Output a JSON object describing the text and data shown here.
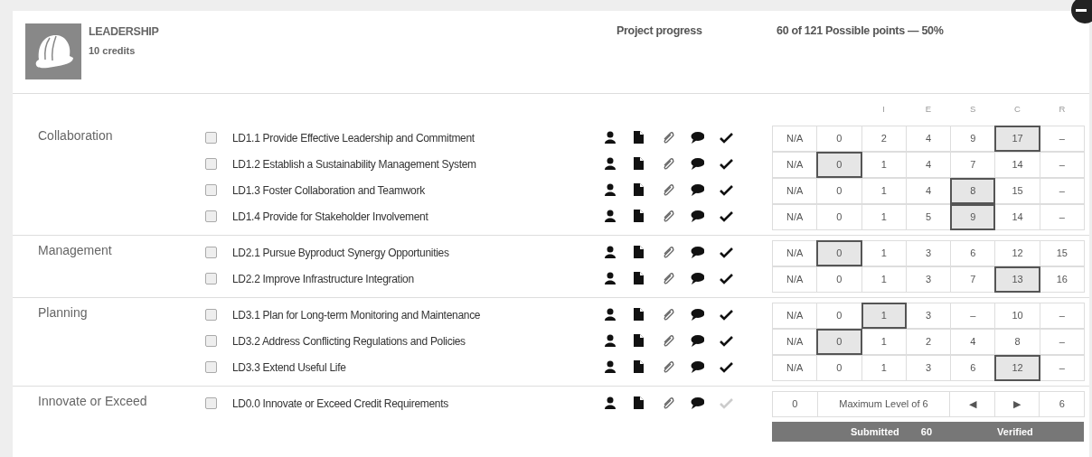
{
  "header": {
    "title": "LEADERSHIP",
    "credits": "10 credits",
    "progress_label": "Project progress",
    "points": "60 of 121 Possible points — 50%"
  },
  "score_columns": [
    "I",
    "E",
    "S",
    "C",
    "R"
  ],
  "sections": [
    {
      "name": "Collaboration",
      "credits": [
        {
          "kind": "levels",
          "label": "LD1.1 Provide Effective Leadership and Commitment",
          "checked": false,
          "done": true,
          "scores": [
            {
              "value": "N/A",
              "selected": false
            },
            {
              "value": "0",
              "selected": false
            },
            {
              "value": "2",
              "selected": false
            },
            {
              "value": "4",
              "selected": false
            },
            {
              "value": "9",
              "selected": false
            },
            {
              "value": "17",
              "selected": true
            },
            {
              "value": "–",
              "selected": false
            }
          ]
        },
        {
          "kind": "levels",
          "label": "LD1.2 Establish a Sustainability Management System",
          "checked": false,
          "done": true,
          "scores": [
            {
              "value": "N/A",
              "selected": false
            },
            {
              "value": "0",
              "selected": true
            },
            {
              "value": "1",
              "selected": false
            },
            {
              "value": "4",
              "selected": false
            },
            {
              "value": "7",
              "selected": false
            },
            {
              "value": "14",
              "selected": false
            },
            {
              "value": "–",
              "selected": false
            }
          ]
        },
        {
          "kind": "levels",
          "label": "LD1.3 Foster Collaboration and Teamwork",
          "checked": false,
          "done": true,
          "scores": [
            {
              "value": "N/A",
              "selected": false
            },
            {
              "value": "0",
              "selected": false
            },
            {
              "value": "1",
              "selected": false
            },
            {
              "value": "4",
              "selected": false
            },
            {
              "value": "8",
              "selected": true
            },
            {
              "value": "15",
              "selected": false
            },
            {
              "value": "–",
              "selected": false
            }
          ]
        },
        {
          "kind": "levels",
          "label": "LD1.4 Provide for Stakeholder Involvement",
          "checked": false,
          "done": true,
          "scores": [
            {
              "value": "N/A",
              "selected": false
            },
            {
              "value": "0",
              "selected": false
            },
            {
              "value": "1",
              "selected": false
            },
            {
              "value": "5",
              "selected": false
            },
            {
              "value": "9",
              "selected": true
            },
            {
              "value": "14",
              "selected": false
            },
            {
              "value": "–",
              "selected": false
            }
          ]
        }
      ]
    },
    {
      "name": "Management",
      "credits": [
        {
          "kind": "levels",
          "label": "LD2.1 Pursue Byproduct Synergy Opportunities",
          "checked": false,
          "done": true,
          "scores": [
            {
              "value": "N/A",
              "selected": false
            },
            {
              "value": "0",
              "selected": true
            },
            {
              "value": "1",
              "selected": false
            },
            {
              "value": "3",
              "selected": false
            },
            {
              "value": "6",
              "selected": false
            },
            {
              "value": "12",
              "selected": false
            },
            {
              "value": "15",
              "selected": false
            }
          ]
        },
        {
          "kind": "levels",
          "label": "LD2.2 Improve Infrastructure Integration",
          "checked": false,
          "done": true,
          "scores": [
            {
              "value": "N/A",
              "selected": false
            },
            {
              "value": "0",
              "selected": false
            },
            {
              "value": "1",
              "selected": false
            },
            {
              "value": "3",
              "selected": false
            },
            {
              "value": "7",
              "selected": false
            },
            {
              "value": "13",
              "selected": true
            },
            {
              "value": "16",
              "selected": false
            }
          ]
        }
      ]
    },
    {
      "name": "Planning",
      "credits": [
        {
          "kind": "levels",
          "label": "LD3.1 Plan for Long-term Monitoring and Maintenance",
          "checked": false,
          "done": true,
          "scores": [
            {
              "value": "N/A",
              "selected": false
            },
            {
              "value": "0",
              "selected": false
            },
            {
              "value": "1",
              "selected": true
            },
            {
              "value": "3",
              "selected": false
            },
            {
              "value": "–",
              "selected": false
            },
            {
              "value": "10",
              "selected": false
            },
            {
              "value": "–",
              "selected": false
            }
          ]
        },
        {
          "kind": "levels",
          "label": "LD3.2 Address Conflicting Regulations and Policies",
          "checked": false,
          "done": true,
          "scores": [
            {
              "value": "N/A",
              "selected": false
            },
            {
              "value": "0",
              "selected": true
            },
            {
              "value": "1",
              "selected": false
            },
            {
              "value": "2",
              "selected": false
            },
            {
              "value": "4",
              "selected": false
            },
            {
              "value": "8",
              "selected": false
            },
            {
              "value": "–",
              "selected": false
            }
          ]
        },
        {
          "kind": "levels",
          "label": "LD3.3 Extend Useful Life",
          "checked": false,
          "done": true,
          "scores": [
            {
              "value": "N/A",
              "selected": false
            },
            {
              "value": "0",
              "selected": false
            },
            {
              "value": "1",
              "selected": false
            },
            {
              "value": "3",
              "selected": false
            },
            {
              "value": "6",
              "selected": false
            },
            {
              "value": "12",
              "selected": true
            },
            {
              "value": "–",
              "selected": false
            }
          ]
        }
      ]
    },
    {
      "name": "Innovate or Exceed",
      "credits": [
        {
          "kind": "innovation",
          "label": "LD0.0 Innovate or Exceed Credit Requirements",
          "checked": false,
          "done": false,
          "min": "0",
          "caption": "Maximum Level of 6",
          "prev": "◀",
          "next": "▶",
          "max": "6"
        }
      ]
    }
  ],
  "summary": {
    "submitted_label": "Submitted",
    "submitted": "60",
    "verified_label": "Verified"
  }
}
